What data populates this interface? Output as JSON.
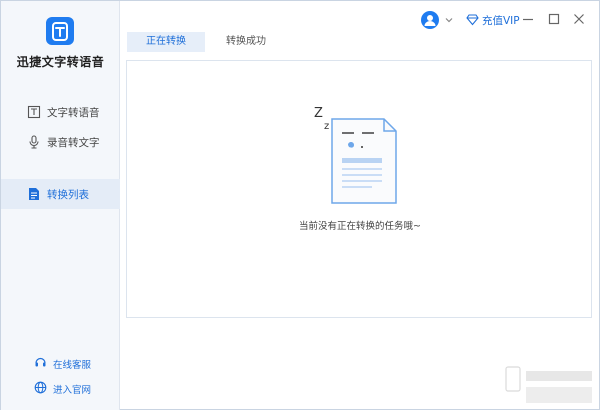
{
  "app": {
    "name": "迅捷文字转语音"
  },
  "sidebar": {
    "items": [
      {
        "label": "文字转语音",
        "icon": "text-document-icon",
        "active": false
      },
      {
        "label": "录音转文字",
        "icon": "microphone-icon",
        "active": false
      },
      {
        "label": "转换列表",
        "icon": "list-document-icon",
        "active": true
      }
    ],
    "footer": [
      {
        "label": "在线客服",
        "icon": "headset-icon"
      },
      {
        "label": "进入官网",
        "icon": "globe-icon"
      }
    ]
  },
  "header": {
    "vip_label": "充值VIP",
    "avatar_icon": "user-avatar-icon"
  },
  "tabs": [
    {
      "label": "正在转换",
      "active": true
    },
    {
      "label": "转换成功",
      "active": false
    }
  ],
  "main": {
    "empty_message": "当前没有正在转换的任务哦~",
    "illustration": "sleeping-document-icon"
  },
  "colors": {
    "accent": "#1f7cf0",
    "sidebar_bg": "#f4f7fb",
    "active_bg": "#e4ecf7"
  }
}
